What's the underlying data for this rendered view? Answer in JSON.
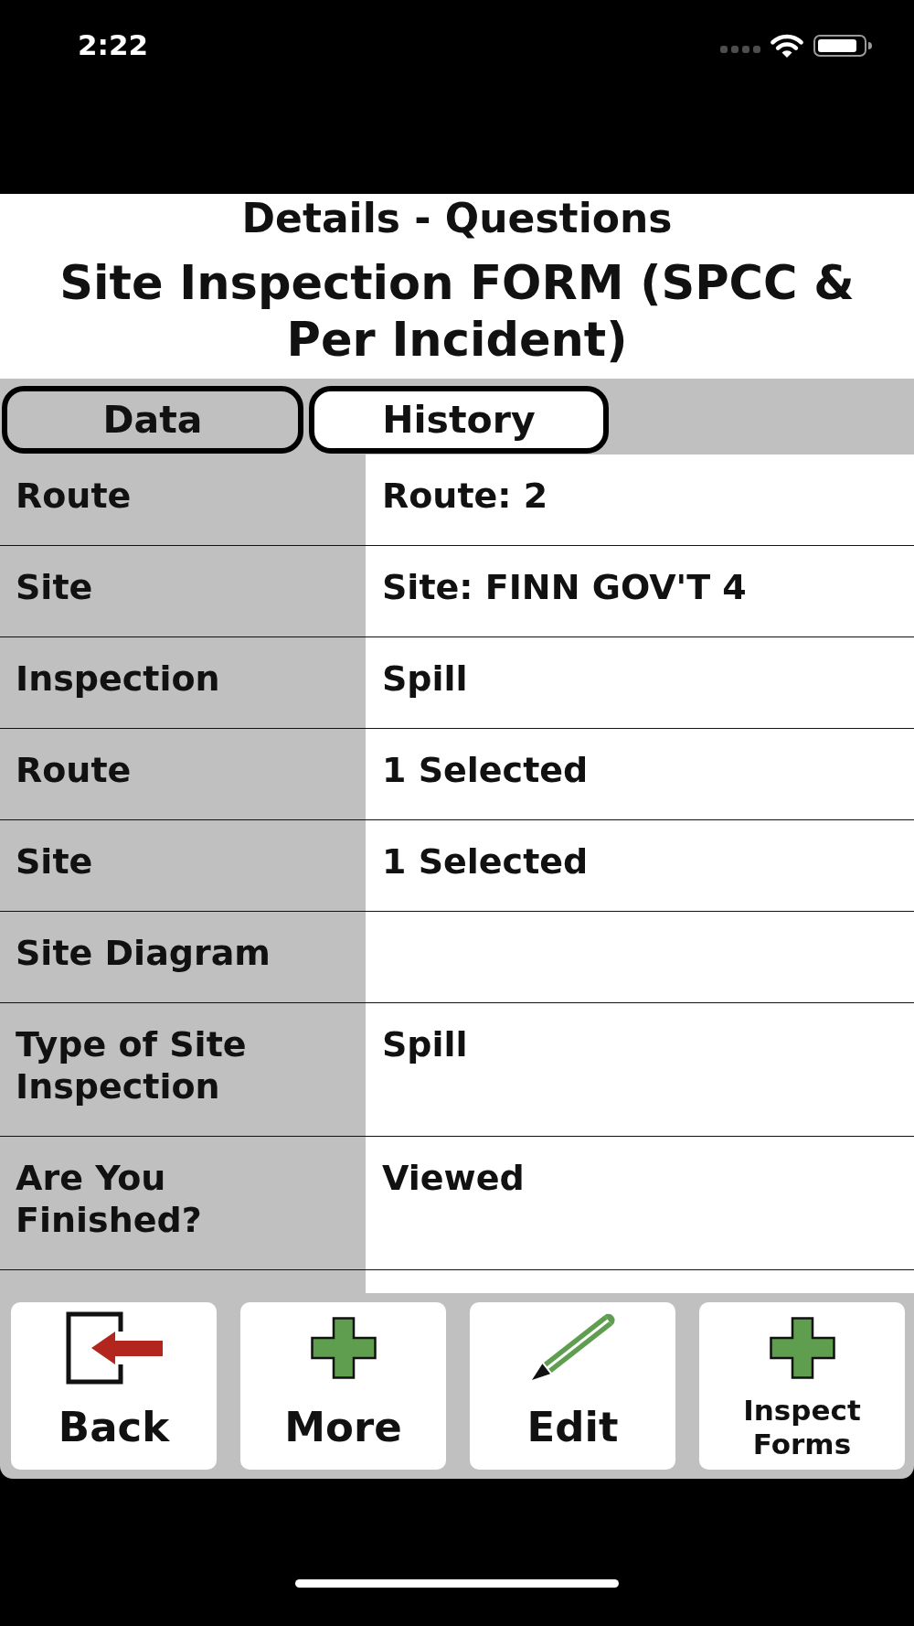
{
  "status_bar": {
    "time": "2:22"
  },
  "header": {
    "subtitle": "Details - Questions",
    "title": "Site Inspection FORM (SPCC & Per Incident)"
  },
  "tabs": [
    {
      "label": "Data",
      "selected": true
    },
    {
      "label": "History",
      "selected": false
    }
  ],
  "rows": [
    {
      "label": "Route",
      "value": "Route: 2"
    },
    {
      "label": "Site",
      "value": "Site: FINN GOV'T 4"
    },
    {
      "label": "Inspection",
      "value": "Spill"
    },
    {
      "label": "Route",
      "value": "1 Selected"
    },
    {
      "label": "Site",
      "value": "1 Selected"
    },
    {
      "label": "Site Diagram"
    },
    {
      "label": "Type of Site Inspection",
      "value": "Spill"
    },
    {
      "label": "Are You Finished?",
      "value": "Viewed"
    }
  ],
  "toolbar": [
    {
      "label": "Back",
      "kind": "exit"
    },
    {
      "label": "More",
      "kind": "add"
    },
    {
      "label": "Edit",
      "kind": "edit"
    },
    {
      "label": "Inspect Forms",
      "kind": "add"
    }
  ]
}
